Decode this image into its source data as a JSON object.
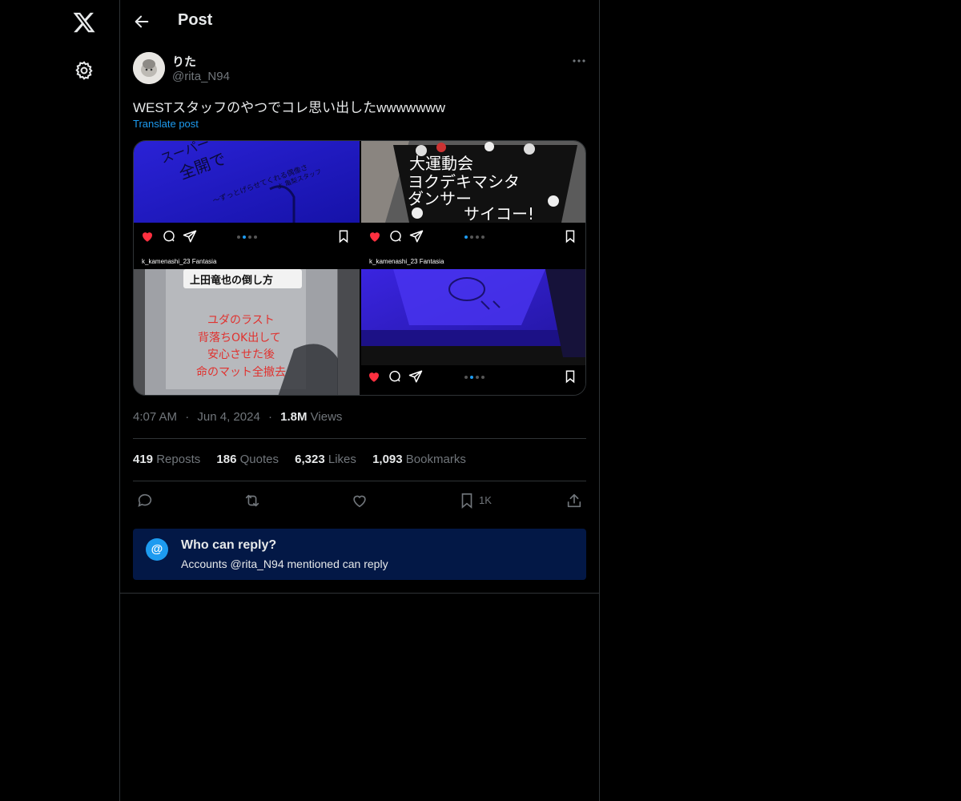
{
  "header": {
    "title": "Post"
  },
  "author": {
    "name": "りた",
    "handle": "@rita_N94"
  },
  "post": {
    "text": "WESTスタッフのやつでコレ思い出したwwwwwww",
    "translate_label": "Translate post"
  },
  "media": {
    "captions": [
      "k_kamenashi_23 Fantasia",
      "k_kamenashi_23 Fantasia"
    ],
    "image_texts": {
      "a": [
        "スーパー",
        "全開で",
        "〜ずっとげらせてくれる偶像さ",
        "よ 亀梨スタッフ"
      ],
      "b": [
        "大運動会",
        "ヨクデキマシタ",
        "ダンサー",
        "サイコー!"
      ],
      "c": [
        "上田竜也の倒し方",
        "ユダのラスト",
        "背落ちOK出して",
        "安心させた後",
        "命のマット全撤去"
      ]
    }
  },
  "meta": {
    "time": "4:07 AM",
    "date": "Jun 4, 2024",
    "views_count": "1.8M",
    "views_label": "Views",
    "sep": "·"
  },
  "stats": [
    {
      "num": "419",
      "label": "Reposts"
    },
    {
      "num": "186",
      "label": "Quotes"
    },
    {
      "num": "6,323",
      "label": "Likes"
    },
    {
      "num": "1,093",
      "label": "Bookmarks"
    }
  ],
  "actions": {
    "bookmark_count": "1K"
  },
  "reply_restriction": {
    "icon_text": "@",
    "title": "Who can reply?",
    "subtitle": "Accounts @rita_N94 mentioned can reply"
  },
  "colors": {
    "accent": "#1d9bf0",
    "like": "#f91880",
    "reply_box": "#031846"
  }
}
